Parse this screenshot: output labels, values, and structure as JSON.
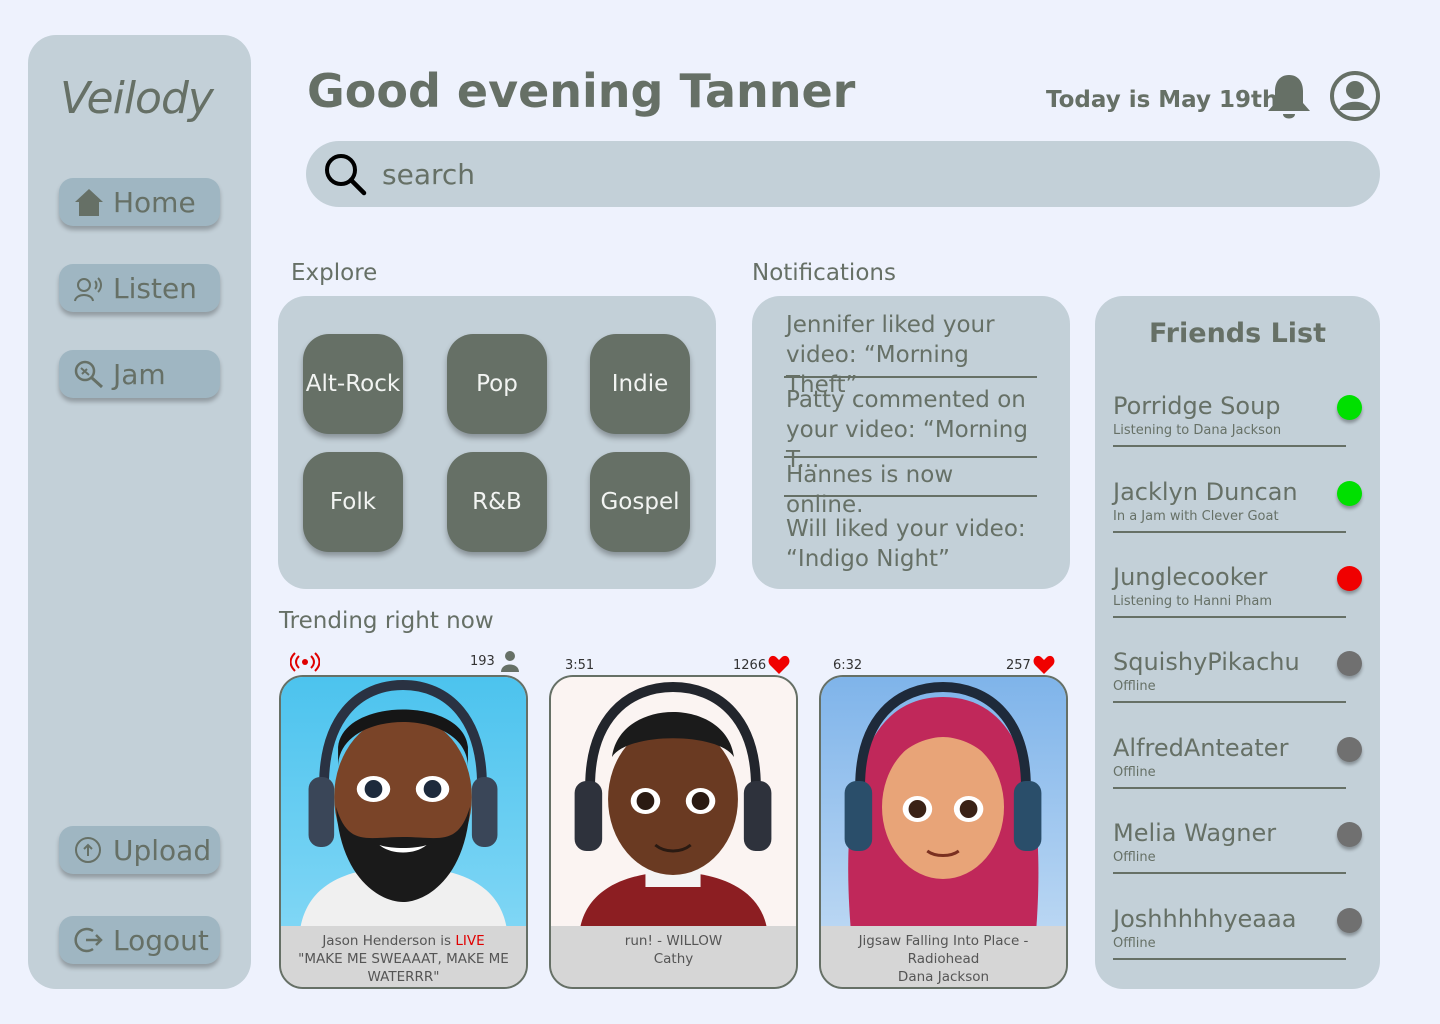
{
  "app": {
    "logo": "Veilody"
  },
  "nav": {
    "home": "Home",
    "listen": "Listen",
    "jam": "Jam",
    "upload": "Upload",
    "logout": "Logout"
  },
  "header": {
    "greeting": "Good evening Tanner",
    "today": "Today is May 19th"
  },
  "search": {
    "placeholder": "search"
  },
  "explore": {
    "label": "Explore",
    "genres": [
      "Alt-Rock",
      "Pop",
      "Indie",
      "Folk",
      "R&B",
      "Gospel"
    ]
  },
  "notifications": {
    "label": "Notifications",
    "items": [
      "Jennifer liked your video: “Morning Theft”",
      "Patty commented on your video: “Morning T...",
      "Hannes is now online.",
      "Will liked your video: “Indigo Night”"
    ]
  },
  "friends": {
    "title": "Friends List",
    "items": [
      {
        "name": "Porridge Soup",
        "status": "Listening to Dana Jackson",
        "color": "#00e000"
      },
      {
        "name": "Jacklyn Duncan",
        "status": "In a Jam with Clever Goat",
        "color": "#00e000"
      },
      {
        "name": "Junglecooker",
        "status": "Listening to Hanni Pham",
        "color": "#f00000"
      },
      {
        "name": "SquishyPikachu",
        "status": "Offline",
        "color": "#707070"
      },
      {
        "name": "AlfredAnteater",
        "status": "Offline",
        "color": "#707070"
      },
      {
        "name": "Melia Wagner",
        "status": "Offline",
        "color": "#707070"
      },
      {
        "name": "Joshhhhhyeaaa",
        "status": "Offline",
        "color": "#707070"
      }
    ]
  },
  "trending": {
    "label": "Trending right now",
    "cards": [
      {
        "left_meta": "live-icon",
        "right_meta": "193",
        "right_icon": "person-icon",
        "line1_prefix": "Jason Henderson is ",
        "line1_live": "LIVE",
        "line2": "\"MAKE ME SWEAAAT, MAKE ME WATERRR\""
      },
      {
        "left_meta": "3:51",
        "right_meta": "1266",
        "right_icon": "heart-icon",
        "line1": "run! - WILLOW",
        "line2": "Cathy"
      },
      {
        "left_meta": "6:32",
        "right_meta": "257",
        "right_icon": "heart-icon",
        "line1": "Jigsaw Falling Into Place - Radiohead",
        "line2": "Dana Jackson"
      }
    ]
  },
  "colors": {
    "panel": "#c3d0d8",
    "accent": "#667066",
    "button": "#9fb6c2",
    "background": "#eef2fd"
  }
}
